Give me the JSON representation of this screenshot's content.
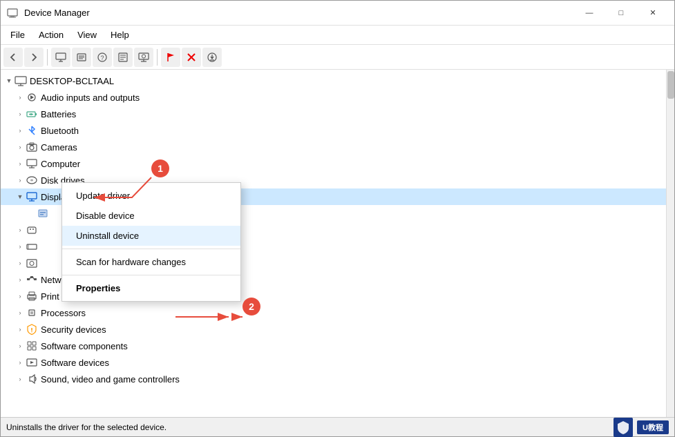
{
  "window": {
    "title": "Device Manager",
    "icon": "⚙️"
  },
  "window_controls": {
    "minimize": "—",
    "maximize": "□",
    "close": "✕"
  },
  "menu": {
    "items": [
      "File",
      "Action",
      "View",
      "Help"
    ]
  },
  "toolbar": {
    "buttons": [
      "←",
      "→",
      "🖥",
      "📋",
      "❓",
      "⬛",
      "🖨",
      "💻",
      "🚩",
      "✖",
      "⬇"
    ]
  },
  "tree": {
    "root": "DESKTOP-BCLTAAL",
    "items": [
      {
        "id": "audio",
        "label": "Audio inputs and outputs",
        "icon": "🔊",
        "indent": 1,
        "expanded": false
      },
      {
        "id": "batteries",
        "label": "Batteries",
        "icon": "🔋",
        "indent": 1,
        "expanded": false
      },
      {
        "id": "bluetooth",
        "label": "Bluetooth",
        "icon": "🔵",
        "indent": 1,
        "expanded": false
      },
      {
        "id": "cameras",
        "label": "Cameras",
        "icon": "📷",
        "indent": 1,
        "expanded": false
      },
      {
        "id": "computer",
        "label": "Computer",
        "icon": "💻",
        "indent": 1,
        "expanded": false
      },
      {
        "id": "disk",
        "label": "Disk drives",
        "icon": "💾",
        "indent": 1,
        "expanded": false
      },
      {
        "id": "display",
        "label": "Display adapters",
        "icon": "🖥",
        "indent": 1,
        "expanded": true,
        "selected": true
      },
      {
        "id": "firmware",
        "label": "",
        "icon": "📦",
        "indent": 2,
        "hidden": false
      },
      {
        "id": "hid",
        "label": "",
        "icon": "⌨",
        "indent": 1,
        "expanded": false
      },
      {
        "id": "ide",
        "label": "",
        "icon": "📀",
        "indent": 1,
        "expanded": false
      },
      {
        "id": "imaging",
        "label": "",
        "icon": "🖼",
        "indent": 1,
        "expanded": false
      },
      {
        "id": "keyboard",
        "label": "",
        "icon": "⌨",
        "indent": 1,
        "expanded": false
      },
      {
        "id": "mice",
        "label": "",
        "icon": "🖱",
        "indent": 1,
        "expanded": false
      },
      {
        "id": "monitors",
        "label": "",
        "icon": "🖥",
        "indent": 1,
        "expanded": false
      },
      {
        "id": "network",
        "label": "Network adapters",
        "icon": "🌐",
        "indent": 1,
        "expanded": false
      },
      {
        "id": "print",
        "label": "Print queues",
        "icon": "🖨",
        "indent": 1,
        "expanded": false
      },
      {
        "id": "processors",
        "label": "Processors",
        "icon": "⚙",
        "indent": 1,
        "expanded": false
      },
      {
        "id": "security",
        "label": "Security devices",
        "icon": "🔒",
        "indent": 1,
        "expanded": false
      },
      {
        "id": "sw_components",
        "label": "Software components",
        "icon": "📦",
        "indent": 1,
        "expanded": false
      },
      {
        "id": "sw_devices",
        "label": "Software devices",
        "icon": "🔊",
        "indent": 1,
        "expanded": false
      },
      {
        "id": "sound",
        "label": "Sound, video and game controllers",
        "icon": "🔊",
        "indent": 1,
        "expanded": false
      }
    ]
  },
  "context_menu": {
    "visible": true,
    "items": [
      {
        "id": "update",
        "label": "Update driver",
        "bold": false,
        "separator_after": false
      },
      {
        "id": "disable",
        "label": "Disable device",
        "bold": false,
        "separator_after": false
      },
      {
        "id": "uninstall",
        "label": "Uninstall device",
        "bold": false,
        "separator_after": false
      },
      {
        "id": "sep1",
        "separator": true
      },
      {
        "id": "scan",
        "label": "Scan for hardware changes",
        "bold": false,
        "separator_after": false
      },
      {
        "id": "sep2",
        "separator": true
      },
      {
        "id": "properties",
        "label": "Properties",
        "bold": true,
        "separator_after": false
      }
    ]
  },
  "annotations": [
    {
      "id": "1",
      "label": "1"
    },
    {
      "id": "2",
      "label": "2"
    }
  ],
  "status_bar": {
    "text": "Uninstalls the driver for the selected device.",
    "watermark_text": "U教程",
    "watermark_icon": "🛡"
  }
}
